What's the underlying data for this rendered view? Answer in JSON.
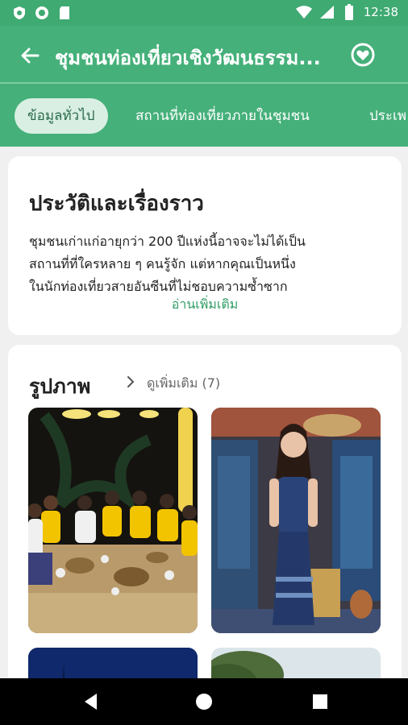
{
  "status": {
    "time": "12:38"
  },
  "appbar": {
    "title": "ชุมชนท่องเที่ยวเชิงวัฒนธรรม..."
  },
  "tabs": [
    {
      "label": "ข้อมูลทั่วไป",
      "active": true
    },
    {
      "label": "สถานที่ท่องเที่ยวภายในชุมชน",
      "active": false
    },
    {
      "label": "ประเพ",
      "active": false
    }
  ],
  "history": {
    "heading": "ประวัติและเรื่องราว",
    "lines": [
      "ชุมชนเก่าแก่อายุกว่า 200 ปีแห่งนี้อาจจะไม่ได้เป็น",
      "สถานที่ที่ใครหลาย ๆ คนรู้จัก แต่หากคุณเป็นหนึ่ง",
      "ในนักท่องเที่ยวสายอันซีนที่ไม่ชอบความซ้ำซาก"
    ],
    "read_more": "อ่านเพิ่มเติม"
  },
  "photos": {
    "heading": "รูปภาพ",
    "see_all": "ดูเพิ่มเติม (7)"
  },
  "colors": {
    "primary": "#45b07a",
    "status": "#3faa72",
    "accent_text": "#2f9d63",
    "chip_bg": "#d9efe3"
  },
  "icons": {
    "back": "arrow-left-icon",
    "favorite": "heart-circle-icon",
    "chevron": "chevron-right-icon"
  }
}
